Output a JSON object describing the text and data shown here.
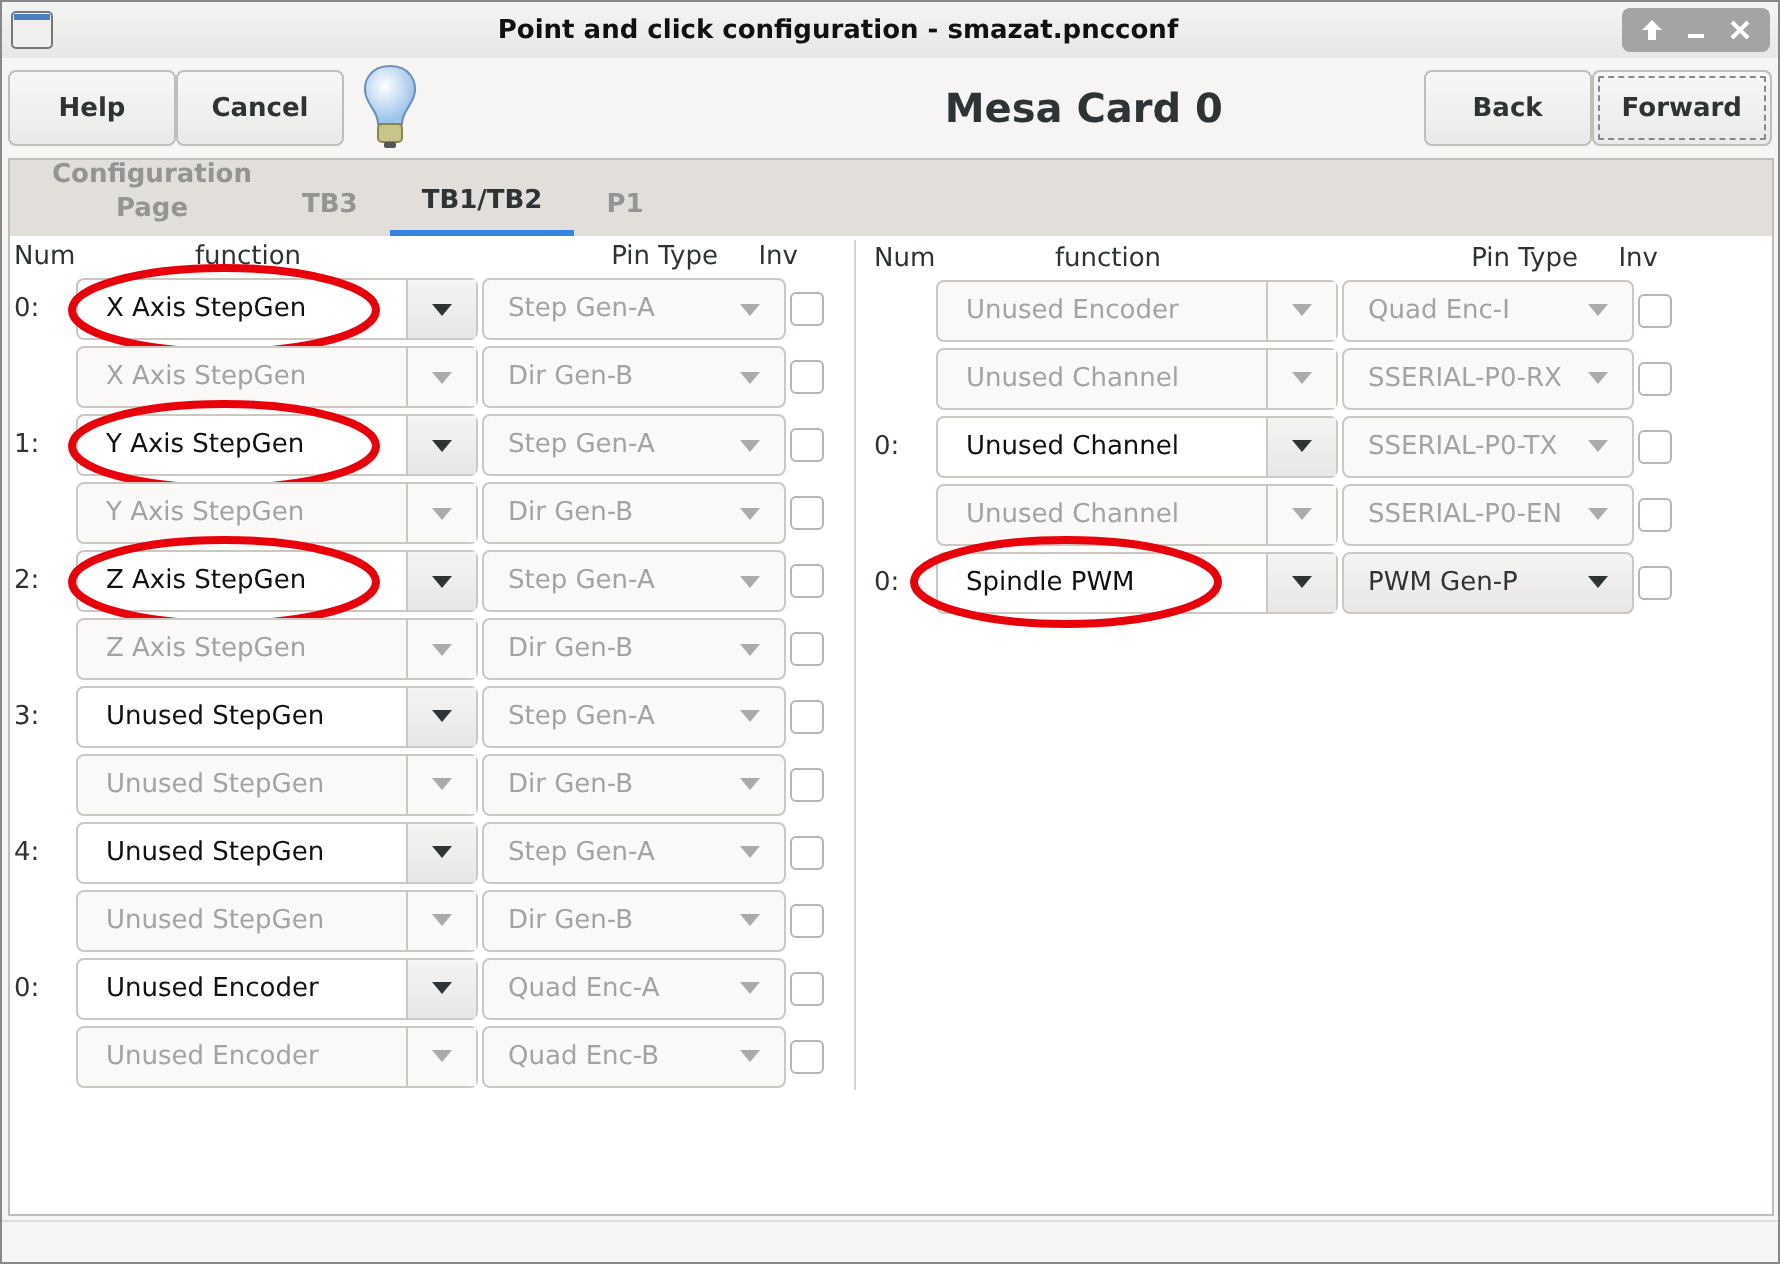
{
  "window": {
    "title": "Point and click configuration - smazat.pncconf"
  },
  "toolbar": {
    "left_buttons": [
      {
        "label": "Help",
        "focused": false
      },
      {
        "label": "Cancel",
        "focused": false
      }
    ],
    "heading": "Mesa Card 0",
    "right_buttons": [
      {
        "label": "Back",
        "focused": false
      },
      {
        "label": "Forward",
        "focused": true
      }
    ]
  },
  "tabs": [
    {
      "label": "Configuration Page",
      "selected": false
    },
    {
      "label": "TB3",
      "selected": false
    },
    {
      "label": "TB1/TB2",
      "selected": true
    },
    {
      "label": "P1",
      "selected": false
    }
  ],
  "panels": [
    {
      "headers": [
        "Num",
        "function",
        "Pin Type",
        "Inv"
      ],
      "rows": [
        {
          "num": "0:",
          "function": "X Axis StepGen",
          "function_enabled": true,
          "pin_type": "Step Gen-A",
          "pin_enabled": false,
          "inv": false,
          "circled": true
        },
        {
          "function": "X Axis StepGen",
          "function_enabled": false,
          "pin_type": "Dir Gen-B",
          "pin_enabled": false,
          "inv": false,
          "circled": false
        },
        {
          "num": "1:",
          "function": "Y Axis StepGen",
          "function_enabled": true,
          "pin_type": "Step Gen-A",
          "pin_enabled": false,
          "inv": false,
          "circled": true
        },
        {
          "function": "Y Axis StepGen",
          "function_enabled": false,
          "pin_type": "Dir Gen-B",
          "pin_enabled": false,
          "inv": false,
          "circled": false
        },
        {
          "num": "2:",
          "function": "Z Axis StepGen",
          "function_enabled": true,
          "pin_type": "Step Gen-A",
          "pin_enabled": false,
          "inv": false,
          "circled": true
        },
        {
          "function": "Z Axis StepGen",
          "function_enabled": false,
          "pin_type": "Dir Gen-B",
          "pin_enabled": false,
          "inv": false,
          "circled": false
        },
        {
          "num": "3:",
          "function": "Unused StepGen",
          "function_enabled": true,
          "pin_type": "Step Gen-A",
          "pin_enabled": false,
          "inv": false,
          "circled": false
        },
        {
          "function": "Unused StepGen",
          "function_enabled": false,
          "pin_type": "Dir Gen-B",
          "pin_enabled": false,
          "inv": false,
          "circled": false
        },
        {
          "num": "4:",
          "function": "Unused StepGen",
          "function_enabled": true,
          "pin_type": "Step Gen-A",
          "pin_enabled": false,
          "inv": false,
          "circled": false
        },
        {
          "function": "Unused StepGen",
          "function_enabled": false,
          "pin_type": "Dir Gen-B",
          "pin_enabled": false,
          "inv": false,
          "circled": false
        },
        {
          "num": "0:",
          "function": "Unused Encoder",
          "function_enabled": true,
          "pin_type": "Quad Enc-A",
          "pin_enabled": false,
          "inv": false,
          "circled": false
        },
        {
          "function": "Unused Encoder",
          "function_enabled": false,
          "pin_type": "Quad Enc-B",
          "pin_enabled": false,
          "inv": false,
          "circled": false
        }
      ]
    },
    {
      "headers": [
        "Num",
        "function",
        "Pin Type",
        "Inv"
      ],
      "rows": [
        {
          "function": "Unused Encoder",
          "function_enabled": false,
          "pin_type": "Quad Enc-I",
          "pin_enabled": false,
          "inv": false,
          "circled": false
        },
        {
          "function": "Unused Channel",
          "function_enabled": false,
          "pin_type": "SSERIAL-P0-RX",
          "pin_enabled": false,
          "inv": false,
          "circled": false
        },
        {
          "num": "0:",
          "function": "Unused Channel",
          "function_enabled": true,
          "pin_type": "SSERIAL-P0-TX",
          "pin_enabled": false,
          "inv": false,
          "circled": false
        },
        {
          "function": "Unused Channel",
          "function_enabled": false,
          "pin_type": "SSERIAL-P0-EN",
          "pin_enabled": false,
          "inv": false,
          "circled": false
        },
        {
          "num": "0:",
          "function": "Spindle PWM",
          "function_enabled": true,
          "pin_type": "PWM Gen-P",
          "pin_enabled": true,
          "inv": false,
          "circled": true
        }
      ]
    }
  ]
}
